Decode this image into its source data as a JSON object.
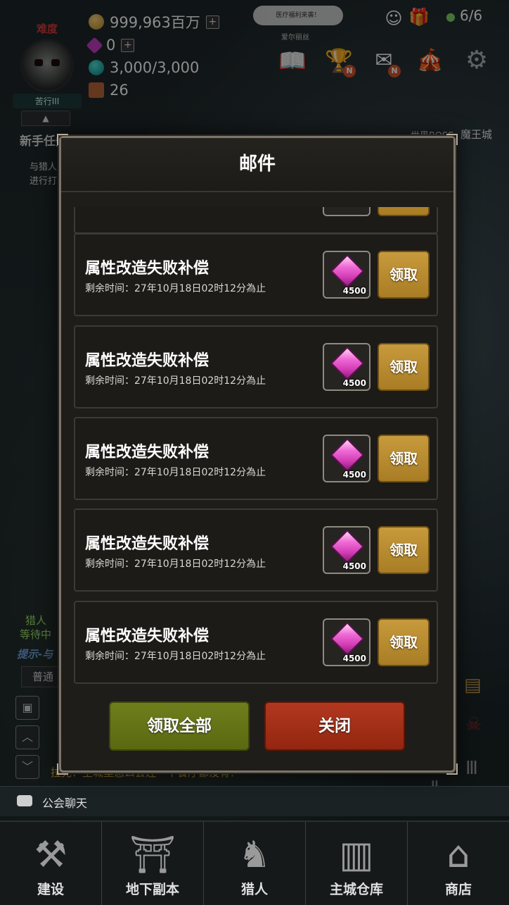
{
  "hud": {
    "difficulty_label": "难度",
    "difficulty_tier": "苦行III",
    "gold": "999,963百万",
    "gems": "0",
    "energy": "3,000/3,000",
    "chests": "26",
    "notice": "医疗福利来袭！",
    "players": "6/6",
    "npc_name": "爱尔丽丝",
    "world_boss_label": "世界BOSS",
    "demon_castle_label": "魔王城"
  },
  "side_panel": {
    "quest_title": "新手任务",
    "quest_text_1": "与猎人",
    "quest_text_2": "进行打",
    "hunter_status_1": "猎人",
    "hunter_status_2": "等待中",
    "hint": "提示-与",
    "chat_tab": "普通",
    "chat_line": "拉克：主城里怎么会连一个餐厅都没有？"
  },
  "guild_chat": {
    "label": "公会聊天"
  },
  "mail": {
    "title": "邮件",
    "items": [
      {
        "title": "属性改造失败补偿",
        "time": "剩余时间：27年10月18日02时12分為止",
        "reward_qty": "4500",
        "claim": "领取"
      },
      {
        "title": "属性改造失败补偿",
        "time": "剩余时间：27年10月18日02时12分為止",
        "reward_qty": "4500",
        "claim": "领取"
      },
      {
        "title": "属性改造失败补偿",
        "time": "剩余时间：27年10月18日02时12分為止",
        "reward_qty": "4500",
        "claim": "领取"
      },
      {
        "title": "属性改造失败补偿",
        "time": "剩余时间：27年10月18日02时12分為止",
        "reward_qty": "4500",
        "claim": "领取"
      },
      {
        "title": "属性改造失败补偿",
        "time": "剩余时间：27年10月18日02时12分為止",
        "reward_qty": "4500",
        "claim": "领取"
      }
    ],
    "claim_all": "领取全部",
    "close": "关闭"
  },
  "bottom_nav": [
    {
      "label": "建设",
      "icon": "hammer-icon"
    },
    {
      "label": "地下副本",
      "icon": "dungeon-gate-icon"
    },
    {
      "label": "猎人",
      "icon": "hunter-icon"
    },
    {
      "label": "主城仓库",
      "icon": "warehouse-chest-icon"
    },
    {
      "label": "商店",
      "icon": "shop-icon"
    }
  ],
  "colors": {
    "claim_button": "#b88a2f",
    "claim_all_button": "#657416",
    "close_button": "#a3301a",
    "gem": "#e052c6"
  }
}
